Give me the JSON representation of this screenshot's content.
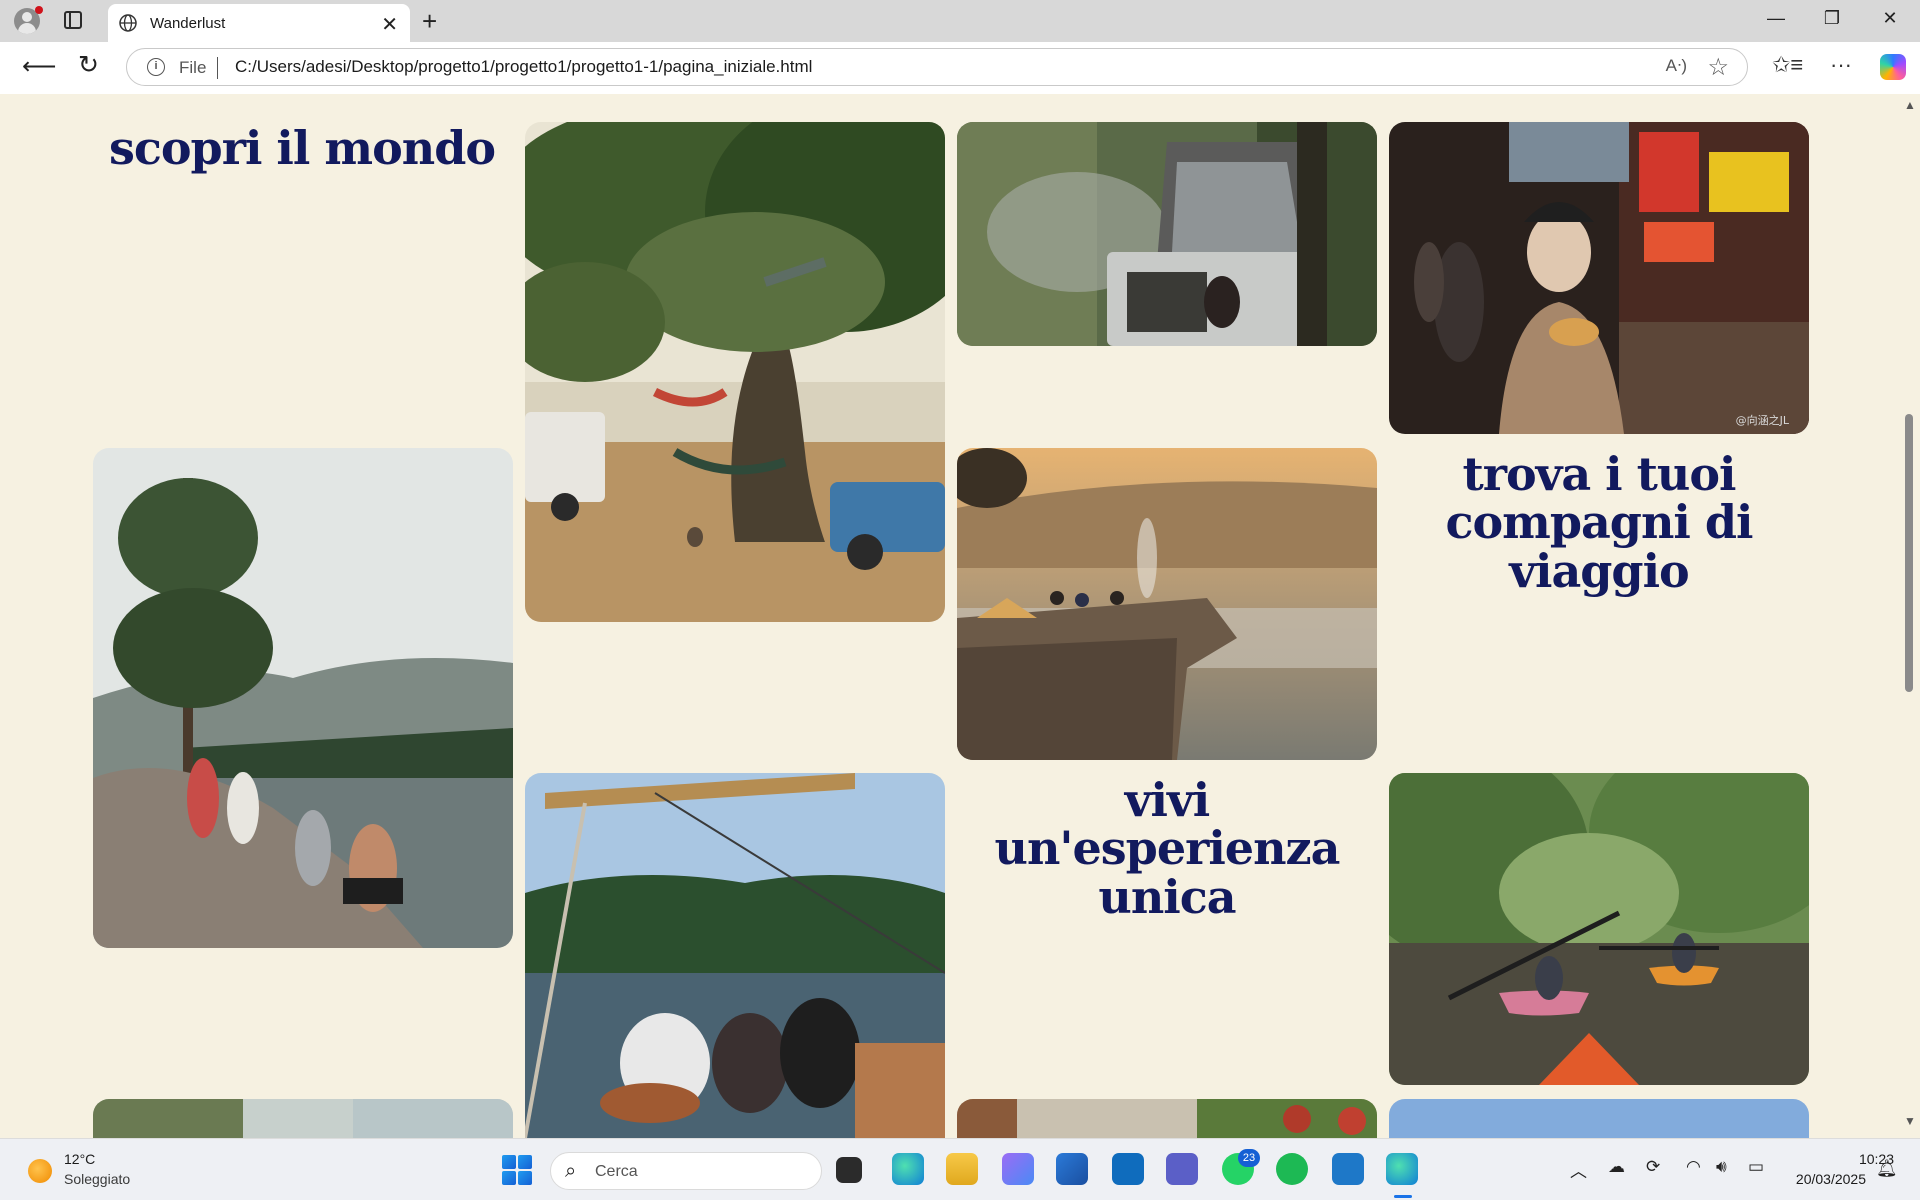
{
  "browser": {
    "tab_title": "Wanderlust",
    "address_scheme": "File",
    "address_url": "C:/Users/adesi/Desktop/progetto1/progetto1/progetto1-1/pagina_iniziale.html",
    "new_tab_symbol": "+",
    "close_symbol": "✕",
    "minimize_symbol": "—",
    "maximize_symbol": "❐",
    "window_close_symbol": "✕"
  },
  "page": {
    "headings": {
      "discover": "scopri il mondo",
      "companions": "trova i tuoi compagni di viaggio",
      "experience": "vivi un'esperienza unica"
    },
    "photos": [
      {
        "name": "oak-tree-hammocks-photo",
        "colors": [
          "#e7e1cf",
          "#8a8f6a",
          "#3e4f2c",
          "#b48e5a"
        ]
      },
      {
        "name": "rooftop-tent-camping-photo",
        "colors": [
          "#4a5a3a",
          "#8b9290",
          "#6f7b5a",
          "#3a2f24"
        ]
      },
      {
        "name": "street-food-market-photo",
        "colors": [
          "#2c2220",
          "#a2683d",
          "#d14b3a",
          "#5a4636"
        ]
      },
      {
        "name": "lakeside-friends-photo",
        "colors": [
          "#dfe3e2",
          "#5e7063",
          "#3b4b36",
          "#9a8b7a"
        ]
      },
      {
        "name": "cliff-sunrise-campers-photo",
        "colors": [
          "#e3b271",
          "#9f8b6e",
          "#8d8a82",
          "#4a4138"
        ]
      },
      {
        "name": "sailboat-guitar-photo",
        "colors": [
          "#a8c6e4",
          "#2c5232",
          "#4d5a64",
          "#a8744a"
        ]
      },
      {
        "name": "river-kayaking-photo",
        "colors": [
          "#6a8c52",
          "#3f5631",
          "#4c4a3a",
          "#c75b7a"
        ]
      },
      {
        "name": "waterfall-photo-partial",
        "colors": [
          "#6a7a52",
          "#c9d2cc"
        ]
      },
      {
        "name": "vegetables-photo-partial",
        "colors": [
          "#c7c0b0",
          "#b03a2a",
          "#5a7a3a"
        ]
      },
      {
        "name": "sky-photo-partial",
        "colors": [
          "#7aa6d8",
          "#a8c4e8"
        ]
      }
    ],
    "photo_watermark": "@向涵之JL"
  },
  "taskbar": {
    "weather_temp": "12°C",
    "weather_desc": "Soleggiato",
    "search_placeholder": "Cerca",
    "whatsapp_badge": "23",
    "time": "10:23",
    "date": "20/03/2025"
  },
  "colors": {
    "page_background": "#f6f1e1",
    "heading_color": "#121a5e"
  }
}
